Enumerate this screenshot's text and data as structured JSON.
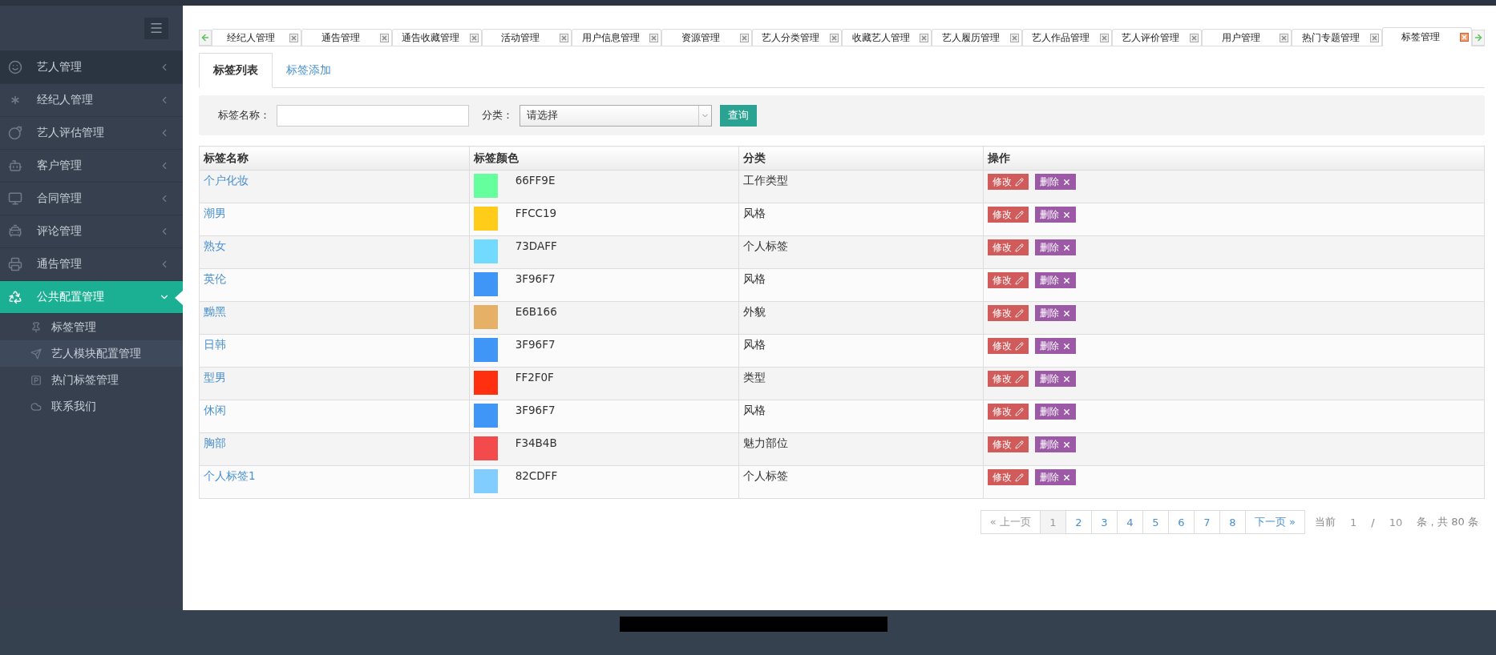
{
  "sidebar": {
    "items": [
      {
        "label": "艺人管理",
        "selected": false,
        "expanded": false,
        "highlighted": true
      },
      {
        "label": "经纪人管理",
        "selected": false,
        "expanded": false,
        "highlighted": false
      },
      {
        "label": "艺人评估管理",
        "selected": false,
        "expanded": false,
        "highlighted": false
      },
      {
        "label": "客户管理",
        "selected": false,
        "expanded": false,
        "highlighted": false
      },
      {
        "label": "合同管理",
        "selected": false,
        "expanded": false,
        "highlighted": false
      },
      {
        "label": "评论管理",
        "selected": false,
        "expanded": false,
        "highlighted": false
      },
      {
        "label": "通告管理",
        "selected": false,
        "expanded": false,
        "highlighted": false
      },
      {
        "label": "公共配置管理",
        "selected": true,
        "expanded": true,
        "highlighted": false,
        "children": [
          {
            "label": "标签管理",
            "highlighted": false
          },
          {
            "label": "艺人模块配置管理",
            "highlighted": true
          },
          {
            "label": "热门标签管理",
            "highlighted": false
          },
          {
            "label": "联系我们",
            "highlighted": false
          }
        ]
      }
    ]
  },
  "tabs": [
    {
      "label": "经纪人管理",
      "selected": false
    },
    {
      "label": "通告管理",
      "selected": false
    },
    {
      "label": "通告收藏管理",
      "selected": false
    },
    {
      "label": "活动管理",
      "selected": false
    },
    {
      "label": "用户信息管理",
      "selected": false
    },
    {
      "label": "资源管理",
      "selected": false
    },
    {
      "label": "艺人分类管理",
      "selected": false
    },
    {
      "label": "收藏艺人管理",
      "selected": false
    },
    {
      "label": "艺人履历管理",
      "selected": false
    },
    {
      "label": "艺人作品管理",
      "selected": false
    },
    {
      "label": "艺人评价管理",
      "selected": false
    },
    {
      "label": "用户管理",
      "selected": false
    },
    {
      "label": "热门专题管理",
      "selected": false
    },
    {
      "label": "标签管理",
      "selected": true
    }
  ],
  "subtabs": [
    {
      "label": "标签列表",
      "selected": true
    },
    {
      "label": "标签添加",
      "selected": false
    }
  ],
  "search": {
    "name_label": "标签名称：",
    "category_label": "分类：",
    "category_value": "请选择",
    "button": "查询"
  },
  "table": {
    "columns": [
      "标签名称",
      "标签颜色",
      "分类",
      "操作"
    ],
    "rows": [
      {
        "name": "个户化妆",
        "color": "#66ff9e",
        "code": "66FF9E",
        "category": "工作类型",
        "edit": "修改",
        "delete": "删除"
      },
      {
        "name": "潮男",
        "color": "#ffcc19",
        "code": "FFCC19",
        "category": "风格",
        "edit": "修改",
        "delete": "删除"
      },
      {
        "name": "熟女",
        "color": "#73daff",
        "code": "73DAFF",
        "category": "个人标签",
        "edit": "修改",
        "delete": "删除"
      },
      {
        "name": "英伦",
        "color": "#3f96f7",
        "code": "3F96F7",
        "category": "风格",
        "edit": "修改",
        "delete": "删除"
      },
      {
        "name": "黝黑",
        "color": "#e6b166",
        "code": "E6B166",
        "category": "外貌",
        "edit": "修改",
        "delete": "删除"
      },
      {
        "name": "日韩",
        "color": "#3f96f7",
        "code": "3F96F7",
        "category": "风格",
        "edit": "修改",
        "delete": "删除"
      },
      {
        "name": "型男",
        "color": "#ff2f0f",
        "code": "FF2F0F",
        "category": "类型",
        "edit": "修改",
        "delete": "删除"
      },
      {
        "name": "休闲",
        "color": "#3f96f7",
        "code": "3F96F7",
        "category": "风格",
        "edit": "修改",
        "delete": "删除"
      },
      {
        "name": "胸部",
        "color": "#f34b4b",
        "code": "F34B4B",
        "category": "魅力部位",
        "edit": "修改",
        "delete": "删除"
      },
      {
        "name": "个人标签1",
        "color": "#82cdff",
        "code": "82CDFF",
        "category": "个人标签",
        "edit": "修改",
        "delete": "删除"
      }
    ]
  },
  "pagination": {
    "prev": "« 上一页",
    "pages": [
      {
        "label": "1",
        "selected": true
      },
      {
        "label": "2",
        "selected": false
      },
      {
        "label": "3",
        "selected": false
      },
      {
        "label": "4",
        "selected": false
      },
      {
        "label": "5",
        "selected": false
      },
      {
        "label": "6",
        "selected": false
      },
      {
        "label": "7",
        "selected": false
      },
      {
        "label": "8",
        "selected": false
      }
    ],
    "next": "下一页 »",
    "current_label": "当前",
    "current": "1",
    "slash": "/",
    "total_pages": "10",
    "summary": "条，共 80 条"
  }
}
